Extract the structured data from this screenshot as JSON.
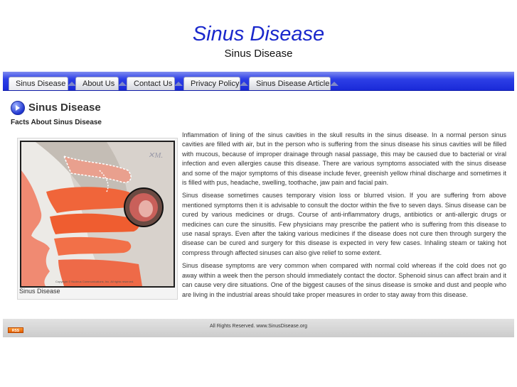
{
  "header": {
    "title": "Sinus Disease",
    "subtitle": "Sinus Disease"
  },
  "nav": {
    "items": [
      {
        "label": "Sinus Disease",
        "active": true
      },
      {
        "label": "About Us",
        "active": false
      },
      {
        "label": "Contact Us",
        "active": false
      },
      {
        "label": "Privacy Policy",
        "active": false
      },
      {
        "label": "Sinus Disease Article",
        "active": false
      }
    ]
  },
  "content": {
    "heading": "Sinus Disease",
    "heading_icon": "arrow-circle-icon",
    "subheading": "Facts About Sinus Disease",
    "image": {
      "caption": "Sinus Disease",
      "watermark": "Copyright © Nucleus Communications, Inc. All rights reserved."
    },
    "paragraphs": [
      "Inflammation of lining of the sinus cavities in the skull results in the sinus disease. In a normal person sinus cavities are filled with air, but in the person who is suffering from the sinus disease his sinus cavities will be filled with mucous, because of improper drainage through nasal passage, this may be caused due to bacterial or viral infection and even allergies cause this disease. There are various symptoms associated with the sinus disease and some of the major symptoms of this disease include fever, greenish yellow rhinal discharge and sometimes it is filled with pus, headache, swelling, toothache, jaw pain and facial pain.",
      "Sinus disease sometimes causes temporary vision loss or blurred vision. If you are suffering from above mentioned symptoms then it is advisable to consult the doctor within the five to seven days. Sinus disease can be cured by various medicines or drugs. Course of anti-inflammatory drugs, antibiotics or anti-allergic drugs or medicines can cure the sinusitis. Few physicians may prescribe the patient who is suffering from this disease to use nasal sprays. Even after the taking various medicines if the disease does not cure then through surgery the disease can be cured and surgery for this disease is expected in very few cases. Inhaling steam or taking hot compress through affected sinuses can also give relief to some extent.",
      "Sinus disease symptoms are very common when compared with normal cold whereas if the cold does not go away within a week then the person should immediately contact the doctor. Sphenoid sinus can affect brain and it can cause very dire situations. One of the biggest causes of the sinus disease is smoke and dust and people who are living in the industrial areas should take proper measures in order to stay away from this disease."
    ]
  },
  "footer": {
    "copyright": "All Rights Reserved. www.SinusDisease.org",
    "rss_label": "RSS",
    "rss_icon": "rss-badge-icon"
  },
  "colors": {
    "title": "#1a28cc",
    "nav_bar": "#2d3fe6",
    "footer_bar": "#d6d6d6"
  }
}
